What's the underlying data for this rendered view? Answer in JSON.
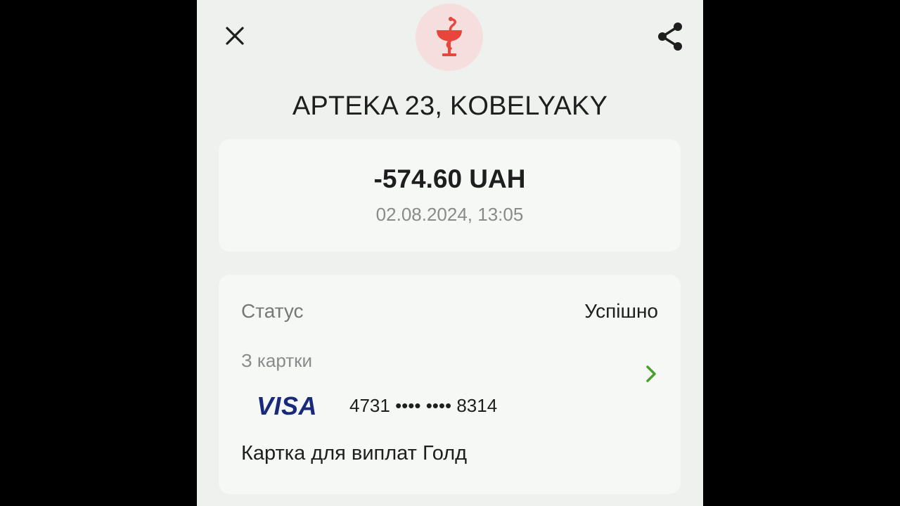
{
  "header": {
    "close_icon": "close-icon",
    "share_icon": "share-icon",
    "merchant_icon": "pharmacy-bowl-of-hygieia-icon",
    "merchant_icon_bg": "#f6dede",
    "merchant_icon_color": "#e8463c"
  },
  "merchant": {
    "name": "APTEKA 23, KOBELYAKY"
  },
  "transaction": {
    "amount": "-574.60 UAH",
    "datetime": "02.08.2024, 13:05"
  },
  "details": {
    "status_label": "Статус",
    "status_value": "Успішно",
    "from_label": "З картки",
    "card_brand": "VISA",
    "card_number": "4731 •••• •••• 8314",
    "card_name": "Картка для виплат Голд",
    "chevron_icon": "chevron-right-icon",
    "accent_color": "#4a9e2f"
  }
}
